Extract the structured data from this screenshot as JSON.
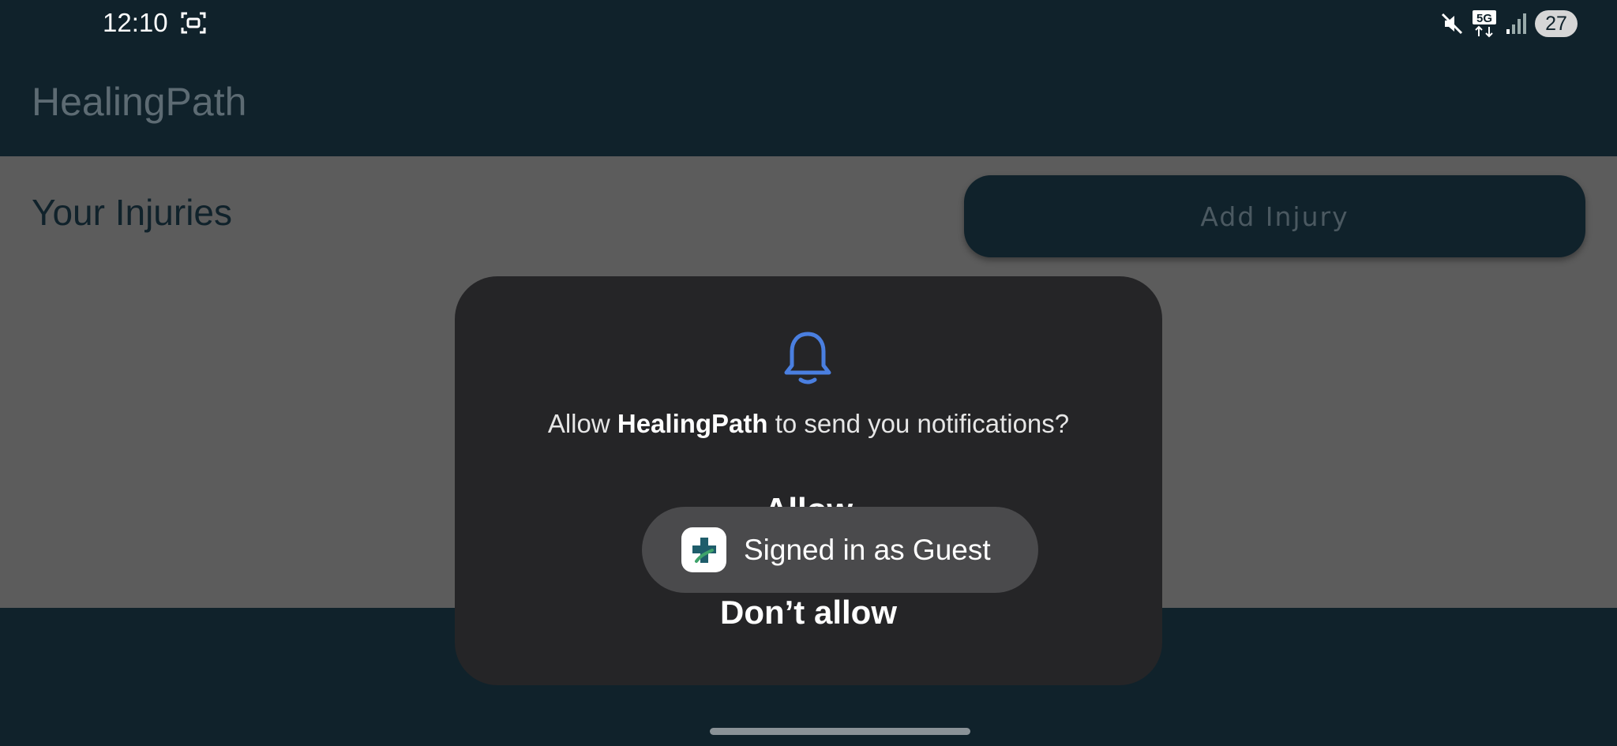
{
  "status_bar": {
    "time": "12:10",
    "battery": "27",
    "icons": [
      "screenshot-icon",
      "mute-icon",
      "5g-icon",
      "signal-icon",
      "battery-icon"
    ]
  },
  "app_bar": {
    "title": "HealingPath"
  },
  "main": {
    "section_title": "Your Injuries",
    "add_injury_label": "Add Injury"
  },
  "permission_dialog": {
    "icon": "bell-icon",
    "message_prefix": "Allow ",
    "message_app": "HealingPath",
    "message_suffix": " to send you notifications?",
    "allow_label": "Allow",
    "dont_allow_label": "Don’t allow"
  },
  "toast": {
    "icon": "app-icon",
    "text": "Signed in as Guest"
  },
  "colors": {
    "app_bar": "#10222b",
    "content_scrim": "#5c5c5c",
    "dialog_bg": "#252527",
    "bell_accent": "#4a7fe0",
    "toast_bg": "#4a4a4c"
  }
}
